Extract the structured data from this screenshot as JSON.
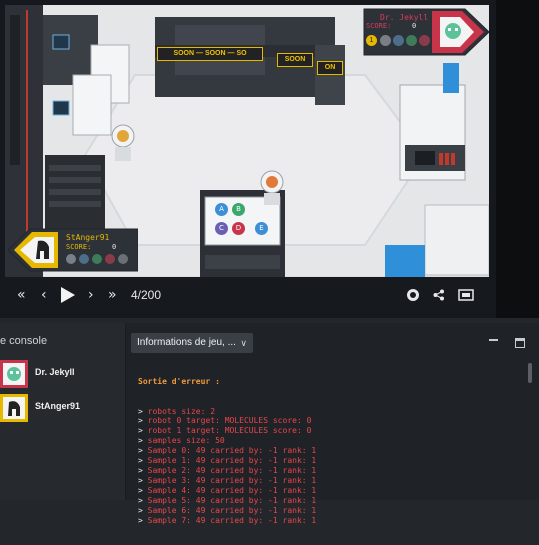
{
  "game": {
    "players_hud": [
      {
        "name": "Dr. Jekyll",
        "score_label": "SCORE:",
        "score": "0",
        "sample_count": "1",
        "side": "top-right"
      },
      {
        "name": "StAnger91",
        "score_label": "SCORE:",
        "score": "0",
        "side": "bottom-left"
      }
    ],
    "signs": [
      "SOON — SOON — SO",
      "SOON",
      "ON"
    ],
    "molecules": [
      "A",
      "B",
      "C",
      "D",
      "E"
    ]
  },
  "controls": {
    "frame": "4/200",
    "icons": [
      "rewind-icon",
      "step-back-icon",
      "play-icon",
      "step-forward-icon",
      "skip-end-icon",
      "gear-icon",
      "share-icon",
      "fullscreen-icon"
    ]
  },
  "console": {
    "title": "e console",
    "players": [
      {
        "name": "Dr. Jekyll"
      },
      {
        "name": "StAnger91"
      }
    ]
  },
  "output": {
    "dropdown_label": "Informations de jeu, ...",
    "header": "Sortie d'erreur :",
    "lines": [
      "robots size: 2",
      "robot 0 target: MOLECULES score: 0",
      "robot 1 target: MOLECULES score: 0",
      "samples size: 50",
      "Sample 0: 49 carried by: -1 rank: 1",
      "Sample 1: 49 carried by: -1 rank: 1",
      "Sample 2: 49 carried by: -1 rank: 1",
      "Sample 3: 49 carried by: -1 rank: 1",
      "Sample 4: 49 carried by: -1 rank: 1",
      "Sample 5: 49 carried by: -1 rank: 1",
      "Sample 6: 49 carried by: -1 rank: 1",
      "Sample 7: 49 carried by: -1 rank: 1"
    ]
  }
}
